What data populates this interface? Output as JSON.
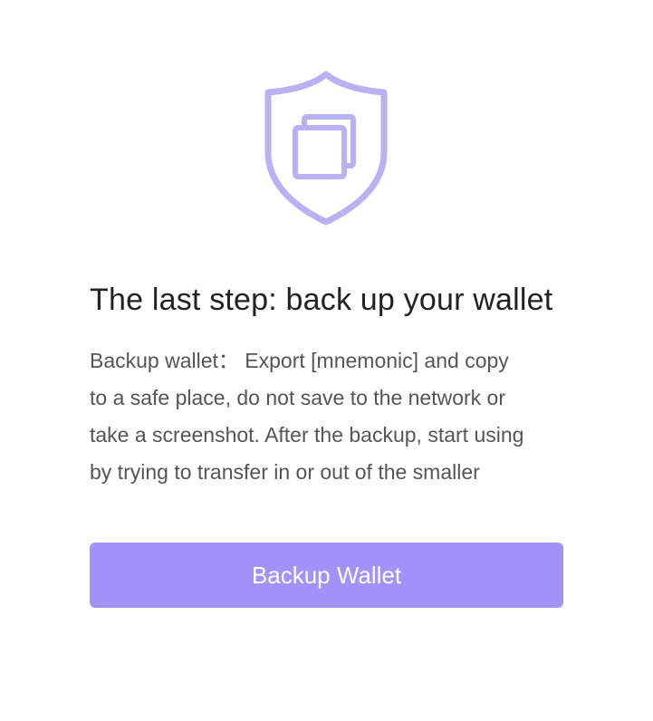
{
  "backup_prompt": {
    "icon": "shield-copy-icon",
    "title": "The last step: back up your wallet",
    "description": "Backup wallet：  Export [mnemonic] and copy\nto a safe place, do not save to the network or\ntake a screenshot. After the backup, start using\nby trying to transfer in or out of the smaller",
    "button_label": "Backup Wallet"
  },
  "colors": {
    "accent": "#A292FB",
    "icon": "#B8B2F4",
    "title": "#222222",
    "body_text": "#555555",
    "background": "#FFFFFF"
  }
}
